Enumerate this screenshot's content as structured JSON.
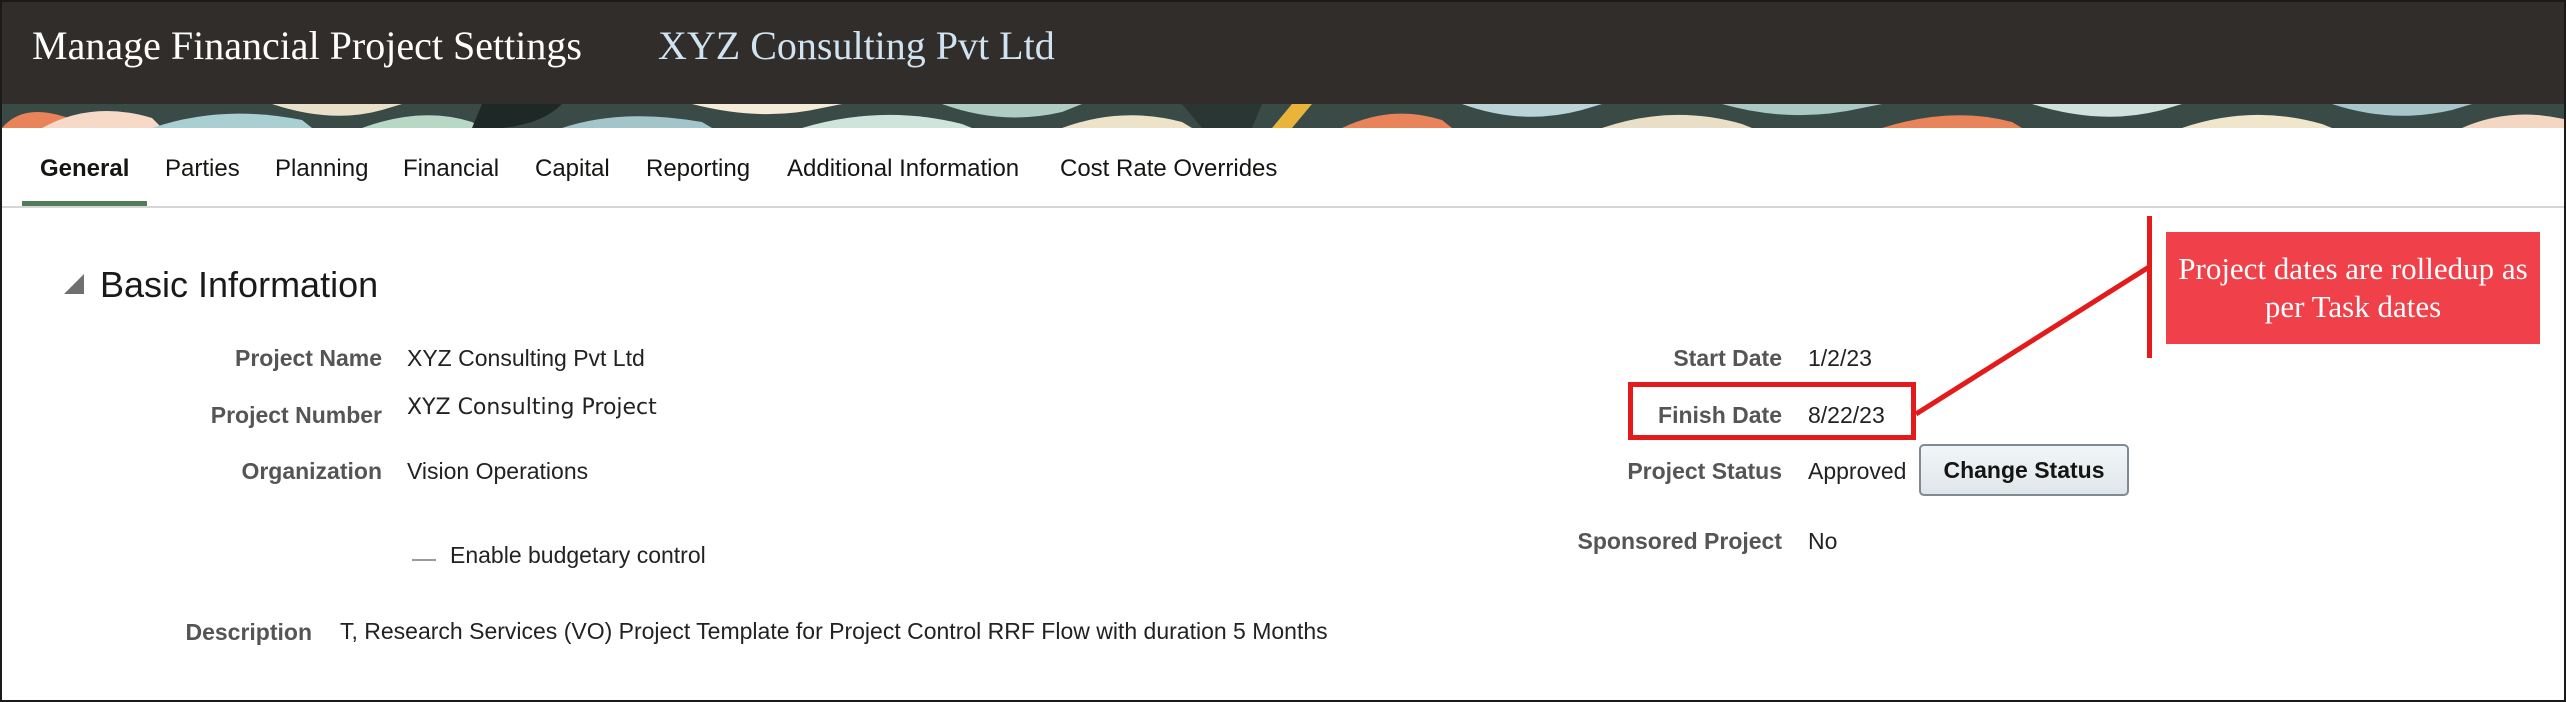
{
  "header": {
    "title": "Manage Financial Project Settings",
    "subtitle": "XYZ Consulting Pvt Ltd"
  },
  "tabs": [
    {
      "label": "General",
      "active": true
    },
    {
      "label": "Parties"
    },
    {
      "label": "Planning"
    },
    {
      "label": "Financial"
    },
    {
      "label": "Capital"
    },
    {
      "label": "Reporting"
    },
    {
      "label": "Additional Information"
    },
    {
      "label": "Cost Rate Overrides"
    }
  ],
  "section": {
    "title": "Basic Information"
  },
  "fields": {
    "project_name": {
      "label": "Project Name",
      "value": "XYZ Consulting Pvt Ltd"
    },
    "project_number": {
      "label": "Project Number",
      "value": "XYZ Consulting Project"
    },
    "organization": {
      "label": "Organization",
      "value": "Vision Operations"
    },
    "budgetary_control": {
      "label": "Enable budgetary control"
    },
    "description": {
      "label": "Description",
      "value": "T, Research Services (VO) Project Template for Project Control RRF Flow with duration 5 Months"
    },
    "start_date": {
      "label": "Start Date",
      "value": "1/2/23"
    },
    "finish_date": {
      "label": "Finish Date",
      "value": "8/22/23"
    },
    "project_status": {
      "label": "Project Status",
      "value": "Approved"
    },
    "sponsored_project": {
      "label": "Sponsored Project",
      "value": "No"
    }
  },
  "buttons": {
    "change_status": "Change Status"
  },
  "annotation": {
    "callout_text": "Project dates are rolledup as per Task dates",
    "color": "#e31b1b"
  },
  "colors": {
    "header_bg": "#312d2a",
    "tab_active_underline": "#4f7d5a",
    "callout_bg": "#f0414a"
  }
}
